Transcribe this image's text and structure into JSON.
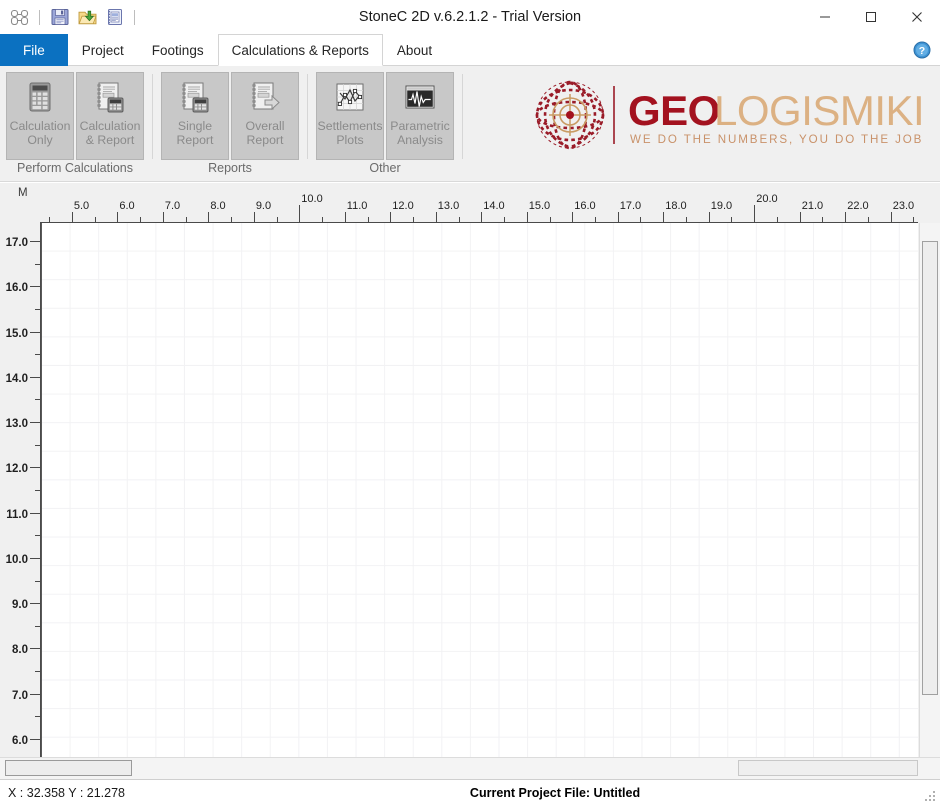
{
  "window": {
    "title": "StoneC 2D v.6.2.1.2 - Trial Version",
    "minimize_label": "—",
    "maximize_label": "☐",
    "close_label": "✕"
  },
  "quick_access": [
    {
      "name": "app-icon",
      "icon": "binoculars-icon",
      "label": ""
    },
    {
      "name": "save",
      "icon": "floppy-save-icon",
      "label": ""
    },
    {
      "name": "open",
      "icon": "open-folder-icon",
      "label": ""
    },
    {
      "name": "report",
      "icon": "notebook-report-icon",
      "label": ""
    }
  ],
  "tabs": [
    {
      "label": "File",
      "kind": "file",
      "active": false
    },
    {
      "label": "Project",
      "kind": "normal",
      "active": false
    },
    {
      "label": "Footings",
      "kind": "normal",
      "active": false
    },
    {
      "label": "Calculations & Reports",
      "kind": "normal",
      "active": true
    },
    {
      "label": "About",
      "kind": "normal",
      "active": false
    }
  ],
  "help": {
    "icon": "help-question-icon",
    "label": "?"
  },
  "ribbon": {
    "groups": [
      {
        "label": "Perform Calculations",
        "buttons": [
          {
            "line1": "Calculation",
            "line2": "Only",
            "icon": "calculator-icon",
            "disabled": true
          },
          {
            "line1": "Calculation",
            "line2": "& Report",
            "icon": "calculator-report-icon",
            "disabled": true
          }
        ]
      },
      {
        "label": "Reports",
        "buttons": [
          {
            "line1": "Single",
            "line2": "Report",
            "icon": "single-report-icon",
            "disabled": true
          },
          {
            "line1": "Overall",
            "line2": "Report",
            "icon": "overall-report-icon",
            "disabled": true
          }
        ]
      },
      {
        "label": "Other",
        "buttons": [
          {
            "line1": "Settlements",
            "line2": "Plots",
            "icon": "settlements-plot-icon",
            "disabled": true
          },
          {
            "line1": "Parametric",
            "line2": "Analysis",
            "icon": "parametric-waveform-icon",
            "disabled": true
          }
        ]
      }
    ]
  },
  "logo": {
    "icon": "globe-target-icon",
    "part1": "GEO",
    "part2": "LOGISMIKI",
    "tagline": "WE DO THE NUMBERS, YOU DO THE JOB!",
    "color1": "#a01020",
    "color2": "#dcb183"
  },
  "workspace": {
    "unit_label": "M",
    "h_axis": {
      "labels": [
        "5.0",
        "6.0",
        "7.0",
        "8.0",
        "9.0",
        "10.0",
        "11.0",
        "12.0",
        "13.0",
        "14.0",
        "15.0",
        "16.0",
        "17.0",
        "18.0",
        "19.0",
        "20.0",
        "21.0",
        "22.0",
        "23.0"
      ],
      "min": 5.0,
      "max": 23.0,
      "emphasized": [
        "10.0",
        "20.0"
      ]
    },
    "v_axis": {
      "labels": [
        "17.0",
        "16.0",
        "15.0",
        "14.0",
        "13.0",
        "12.0",
        "11.0",
        "10.0",
        "9.0",
        "8.0",
        "7.0",
        "6.0"
      ],
      "top": 17.0,
      "bottom": 6.0
    }
  },
  "status": {
    "coords": "X : 32.358 Y : 21.278",
    "project": "Current Project File: Untitled"
  },
  "chart_data": {
    "type": "table",
    "title": "",
    "xlabel": "M",
    "ylabel": "M",
    "x_ticks": [
      5.0,
      6.0,
      7.0,
      8.0,
      9.0,
      10.0,
      11.0,
      12.0,
      13.0,
      14.0,
      15.0,
      16.0,
      17.0,
      18.0,
      19.0,
      20.0,
      21.0,
      22.0,
      23.0
    ],
    "y_ticks": [
      17.0,
      16.0,
      15.0,
      14.0,
      13.0,
      12.0,
      11.0,
      10.0,
      9.0,
      8.0,
      7.0,
      6.0
    ],
    "xlim": [
      4.3,
      23.6
    ],
    "ylim": [
      5.6,
      17.4
    ],
    "grid": true,
    "series": [],
    "note": "Empty drawing canvas — no geometry drawn"
  }
}
